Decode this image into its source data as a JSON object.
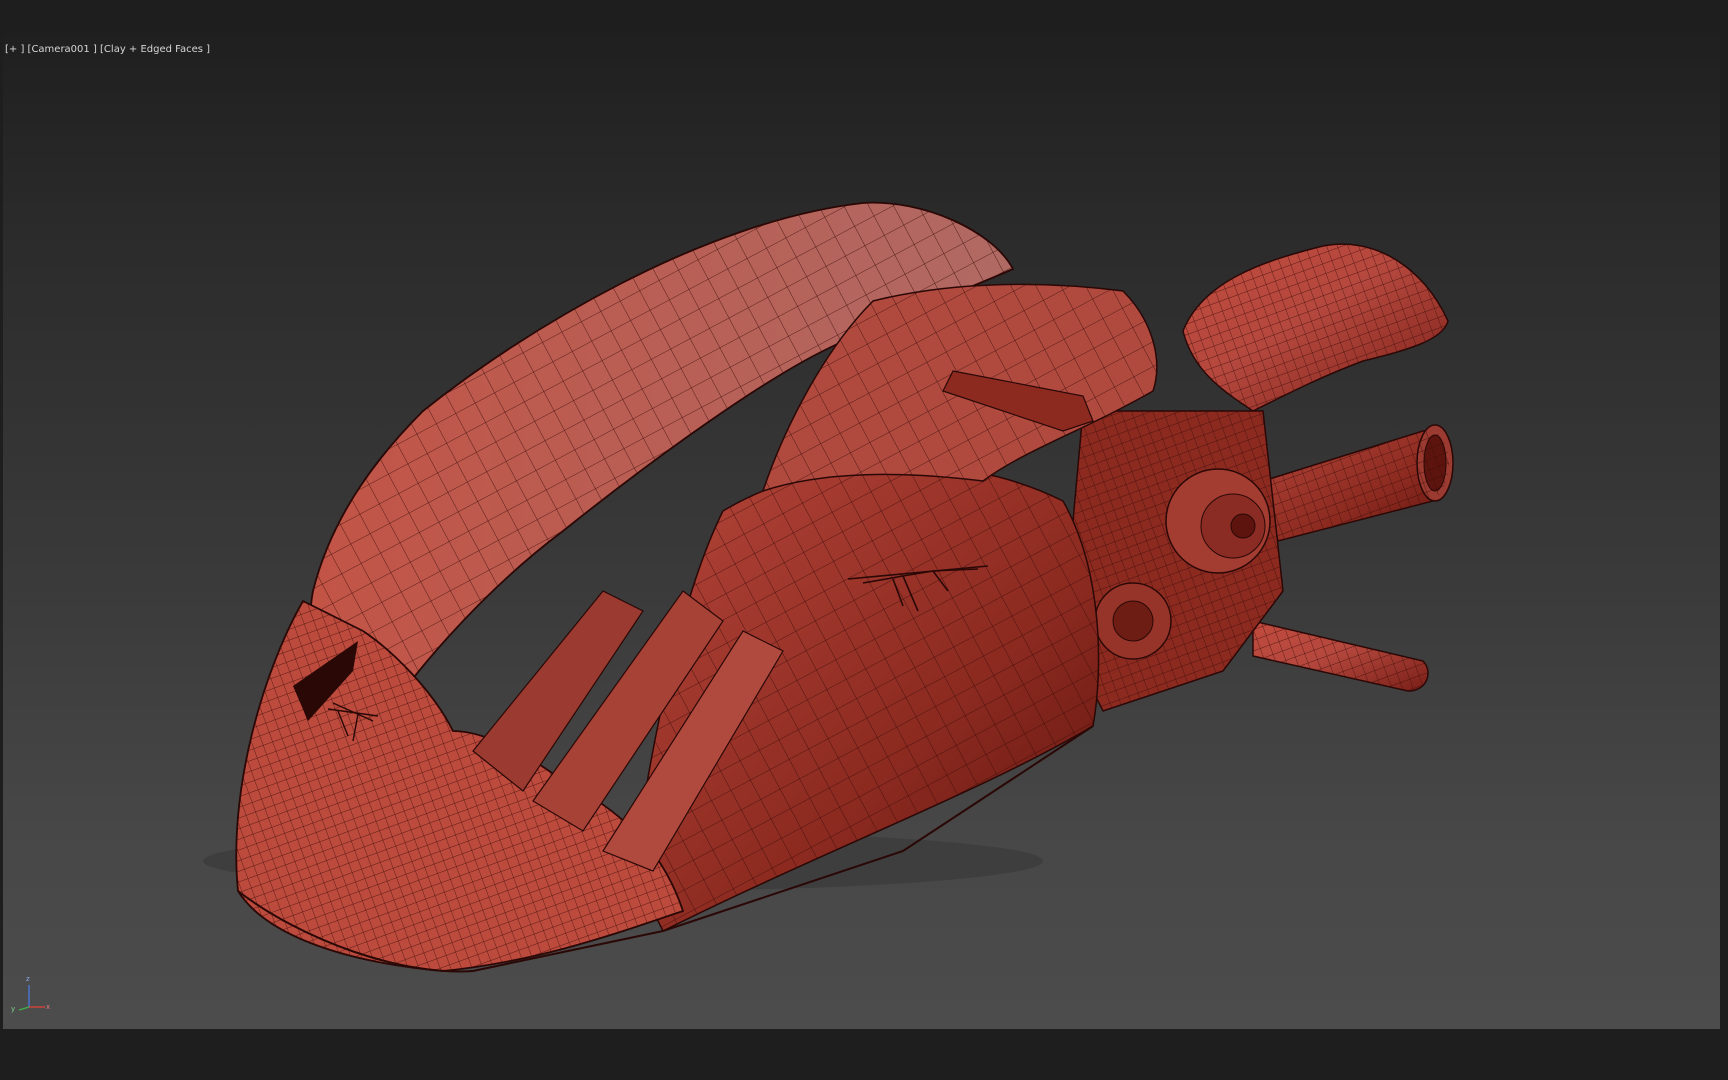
{
  "viewport": {
    "label": "[+ ] [Camera001 ] [Clay + Edged Faces ]",
    "render_mode": "Clay + Edged Faces",
    "camera": "Camera001",
    "model_color": "#b0473c",
    "wire_color": "#2a0806",
    "background_top": "#1f1f1f",
    "background_bottom": "#4c4c4c"
  },
  "axis_gizmo": {
    "z_label": "z",
    "x_label": "x",
    "y_label": "y",
    "x_color": "#e0403a",
    "y_color": "#3fb24a",
    "z_color": "#4a78e0"
  }
}
